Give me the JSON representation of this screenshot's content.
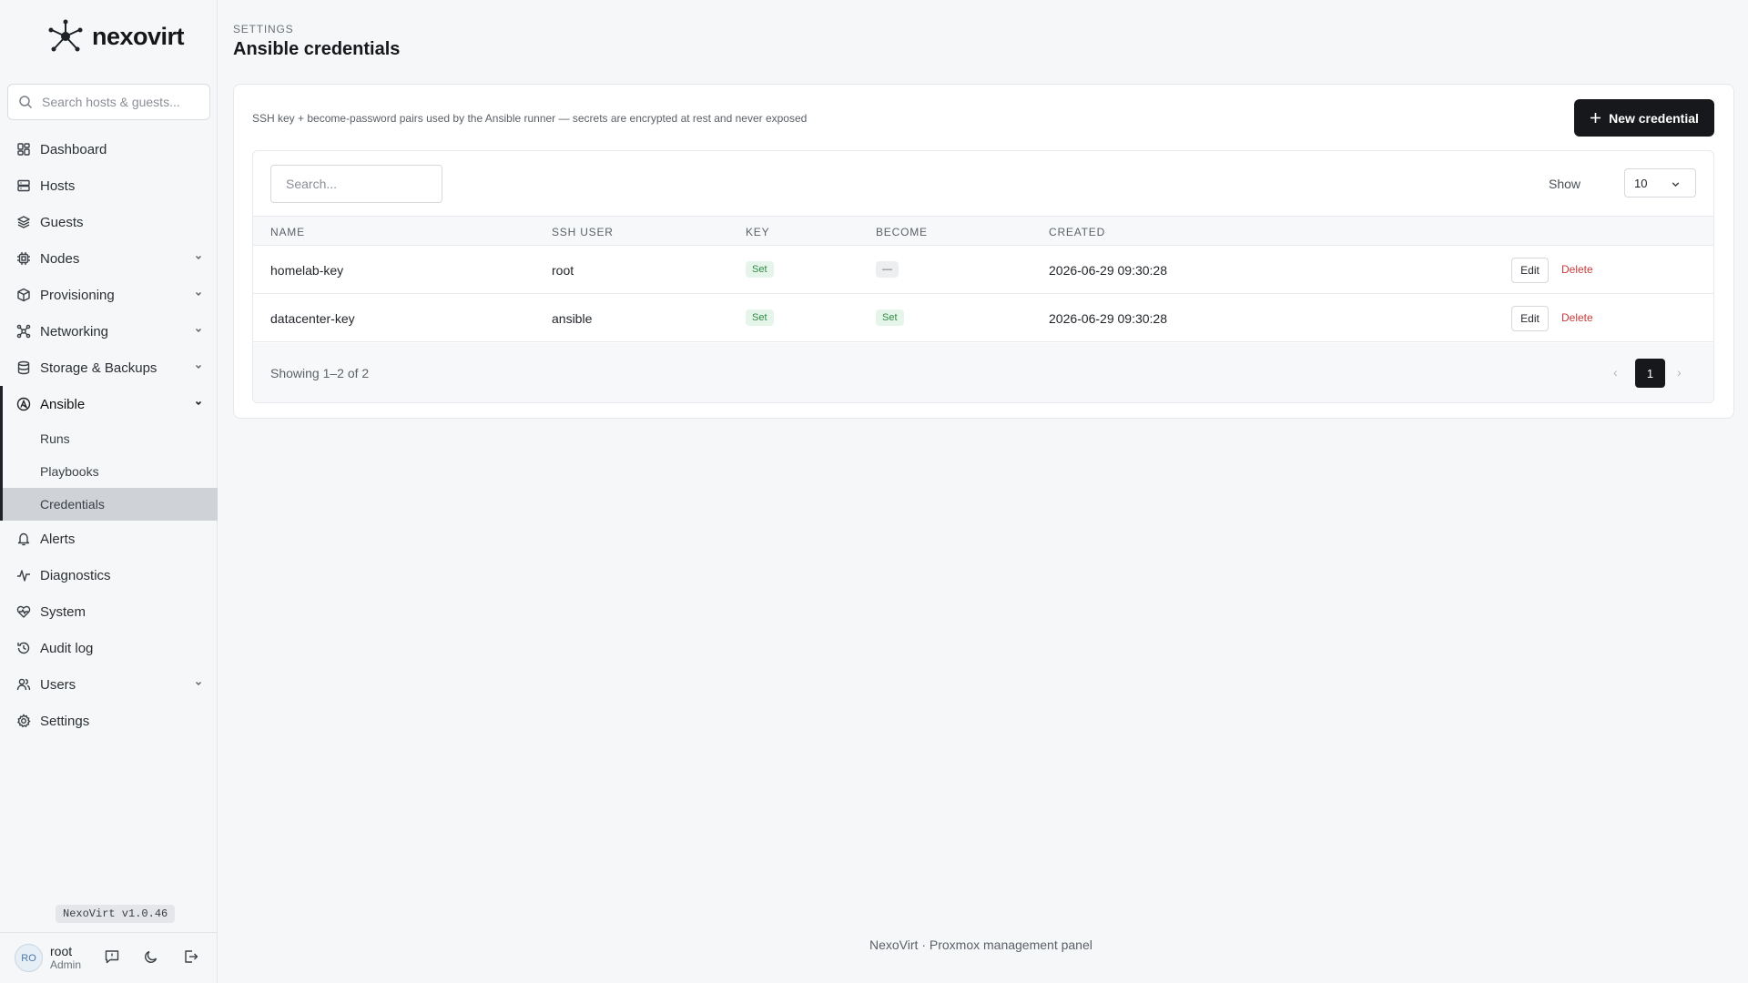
{
  "brand": {
    "name": "nexovirt"
  },
  "sidebar": {
    "search_placeholder": "Search hosts & guests...",
    "items": [
      {
        "label": "Dashboard",
        "icon": "dashboard-icon"
      },
      {
        "label": "Hosts",
        "icon": "server-icon"
      },
      {
        "label": "Guests",
        "icon": "layers-icon"
      },
      {
        "label": "Nodes",
        "icon": "chip-icon",
        "expandable": true
      },
      {
        "label": "Provisioning",
        "icon": "box-icon",
        "expandable": true
      },
      {
        "label": "Networking",
        "icon": "network-icon",
        "expandable": true
      },
      {
        "label": "Storage & Backups",
        "icon": "database-icon",
        "expandable": true
      },
      {
        "label": "Ansible",
        "icon": "ansible-icon",
        "expandable": true,
        "open": true,
        "children": [
          {
            "label": "Runs"
          },
          {
            "label": "Playbooks"
          },
          {
            "label": "Credentials",
            "active": true
          }
        ]
      },
      {
        "label": "Alerts",
        "icon": "bell-icon"
      },
      {
        "label": "Diagnostics",
        "icon": "activity-icon"
      },
      {
        "label": "System",
        "icon": "heart-pulse-icon"
      },
      {
        "label": "Audit log",
        "icon": "history-icon"
      },
      {
        "label": "Users",
        "icon": "users-icon",
        "expandable": true
      },
      {
        "label": "Settings",
        "icon": "gear-icon"
      }
    ],
    "version": "NexoVirt v1.0.46",
    "user": {
      "initials": "RO",
      "name": "root",
      "role": "Admin"
    }
  },
  "header": {
    "breadcrumb": "SETTINGS",
    "title": "Ansible credentials"
  },
  "card": {
    "description": "SSH key + become-password pairs used by the Ansible runner — secrets are encrypted at rest and never exposed",
    "new_button": "New credential"
  },
  "table": {
    "search_placeholder": "Search...",
    "show_label": "Show",
    "page_size": "10",
    "columns": [
      "NAME",
      "SSH USER",
      "KEY",
      "BECOME",
      "CREATED"
    ],
    "rows": [
      {
        "name": "homelab-key",
        "ssh_user": "root",
        "key": "Set",
        "become": "—",
        "created": "2026-06-29 09:30:28"
      },
      {
        "name": "datacenter-key",
        "ssh_user": "ansible",
        "key": "Set",
        "become": "Set",
        "created": "2026-06-29 09:30:28"
      }
    ],
    "actions": {
      "edit": "Edit",
      "delete": "Delete"
    },
    "showing": "Showing 1–2 of 2",
    "pagination": {
      "prev": "‹",
      "current": "1",
      "next": "›"
    }
  },
  "footer": "NexoVirt · Proxmox management panel",
  "colors": {
    "accent": "#16181b",
    "success": "#2e8a45",
    "danger": "#c83a3a"
  }
}
